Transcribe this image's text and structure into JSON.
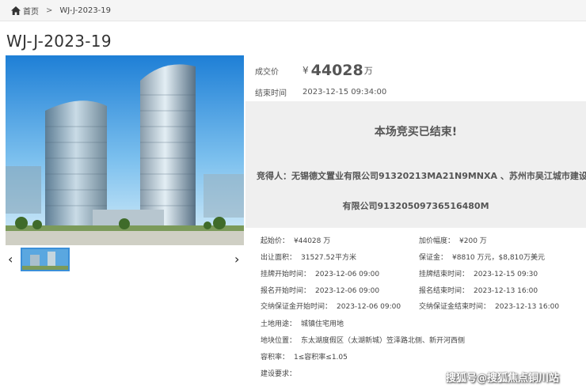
{
  "breadcrumb": {
    "home": "首页",
    "separator": ">",
    "current": "WJ-J-2023-19"
  },
  "page_title": "WJ-J-2023-19",
  "deal": {
    "price_label": "成交价",
    "currency": "¥",
    "price": "44028",
    "price_unit": "万",
    "end_label": "结束时间",
    "end_time": "2023-12-15 09:34:00"
  },
  "result": {
    "title": "本场竞买已结束!",
    "winner_line1": "竞得人：无锡德文置业有限公司91320213MA21N9MNXA 、苏州市吴江城市建设开发",
    "winner_line2": "有限公司91320509736516480M"
  },
  "details": [
    {
      "k": "起始价：",
      "v": "¥44028 万"
    },
    {
      "k": "加价幅度：",
      "v": "¥200 万"
    },
    {
      "k": "出让面积：",
      "v": "31527.52平方米"
    },
    {
      "k": "保证金：",
      "v": "¥8810 万元，$8,810万美元"
    },
    {
      "k": "挂牌开始时间：",
      "v": "2023-12-06 09:00"
    },
    {
      "k": "挂牌结束时间：",
      "v": "2023-12-15 09:30"
    },
    {
      "k": "报名开始时间：",
      "v": "2023-12-06 09:00"
    },
    {
      "k": "报名结束时间：",
      "v": "2023-12-13 16:00"
    },
    {
      "k": "交纳保证金开始时间：",
      "v": "2023-12-06 09:00"
    },
    {
      "k": "交纳保证金结束时间：",
      "v": "2023-12-13 16:00"
    },
    {
      "k": "土地用途：",
      "v": "城镇住宅用地"
    },
    {
      "k": "地块位置：",
      "v": "东太湖度假区（太湖新城）笠泽路北侧、新开河西侧"
    },
    {
      "k": "容积率：",
      "v": "1≤容积率≤1.05"
    },
    {
      "k": "建设要求：",
      "v": ""
    }
  ],
  "gallery": {
    "prev_arrow": "‹",
    "next_arrow": "›"
  },
  "watermark": "搜狐号@搜狐焦点铜川站",
  "colors": {
    "panel_bg": "#efefef",
    "thumb_border": "#3b8fd8",
    "breadcrumb_bg": "#f5f5f5"
  }
}
